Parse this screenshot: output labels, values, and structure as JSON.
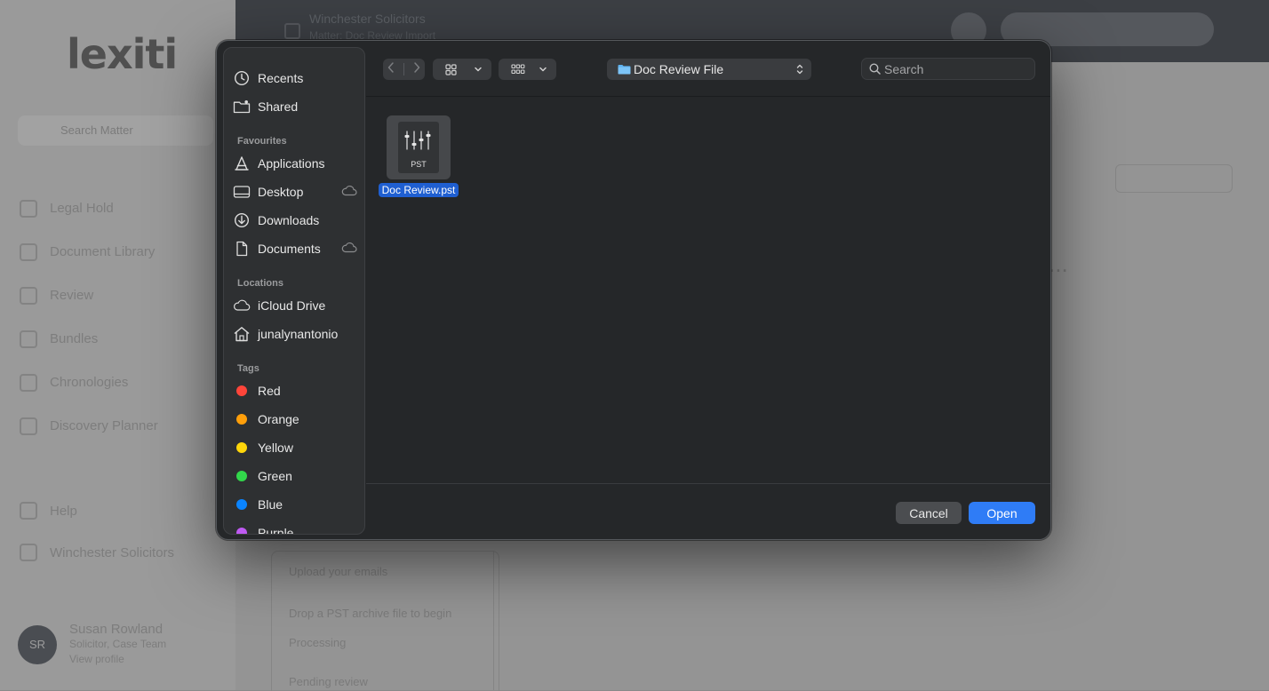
{
  "background": {
    "logo": "lexiti",
    "search_placeholder": "Search Matter",
    "nav": [
      "Legal Hold",
      "Document Library",
      "Review",
      "Bundles",
      "Chronologies",
      "Discovery Planner"
    ],
    "help": "Help",
    "org": "Winchester Solicitors",
    "user": {
      "initials": "SR",
      "name": "Susan Rowland",
      "line1": "Solicitor, Case Team",
      "line2": "View profile"
    },
    "topbar": {
      "title": "Winchester Solicitors",
      "subtitle": "Matter: Doc Review Import"
    },
    "lower_lines": [
      "Upload your emails",
      "Drop a PST archive file to begin",
      "Processing",
      "Pending review"
    ]
  },
  "dialog": {
    "sidebar": {
      "top": [
        {
          "label": "Recents",
          "icon": "clock-icon"
        },
        {
          "label": "Shared",
          "icon": "shared-folder-icon"
        }
      ],
      "favourites_header": "Favourites",
      "favourites": [
        {
          "label": "Applications",
          "icon": "applications-icon",
          "cloud": false
        },
        {
          "label": "Desktop",
          "icon": "desktop-icon",
          "cloud": true
        },
        {
          "label": "Downloads",
          "icon": "downloads-icon",
          "cloud": false
        },
        {
          "label": "Documents",
          "icon": "document-icon",
          "cloud": true
        }
      ],
      "locations_header": "Locations",
      "locations": [
        {
          "label": "iCloud Drive",
          "icon": "cloud-icon"
        },
        {
          "label": "junalynantonio",
          "icon": "home-icon"
        }
      ],
      "tags_header": "Tags",
      "tags": [
        {
          "label": "Red",
          "color": "#ff453a"
        },
        {
          "label": "Orange",
          "color": "#ff9f0a"
        },
        {
          "label": "Yellow",
          "color": "#ffd60a"
        },
        {
          "label": "Green",
          "color": "#32d74b"
        },
        {
          "label": "Blue",
          "color": "#0a84ff"
        },
        {
          "label": "Purple",
          "color": "#bf5af2"
        }
      ]
    },
    "toolbar": {
      "current_folder": "Doc Review File",
      "search_placeholder": "Search"
    },
    "files": [
      {
        "name": "Doc Review.pst",
        "ext": "PST",
        "selected": true
      }
    ],
    "cancel_label": "Cancel",
    "open_label": "Open",
    "accent": "#2f7cf6",
    "selection_color": "#1f5fd1"
  }
}
